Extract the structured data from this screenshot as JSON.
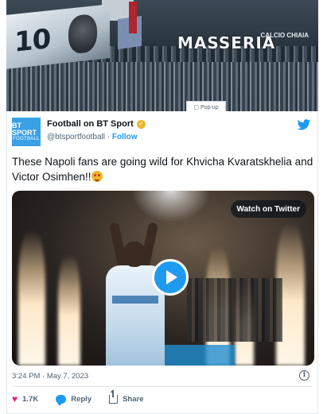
{
  "banner": {
    "flag_number": "10",
    "sign_text": "MASSERIA",
    "sign_side": "CALCIO CHIAIA",
    "popup_label": "Pop-up"
  },
  "tweet": {
    "account_name": "Football on BT Sport",
    "avatar_line1": "BT SPORT",
    "avatar_line2": "FOOTBALL",
    "handle": "@btsportfootball",
    "separator": " · ",
    "follow_label": "Follow",
    "text": "These Napoli fans are going wild for Khvicha Kvaratskhelia and Victor Osimhen!!",
    "watch_label": "Watch on Twitter",
    "timestamp": "3:24 PM · May 7, 2023",
    "info_icon": "i",
    "likes": "1.7K",
    "reply_label": "Reply",
    "share_label": "Share"
  },
  "colors": {
    "accent": "#1d9bf0",
    "like": "#f91880",
    "verified": "#e8b92d"
  },
  "icons": {
    "verified": "verified-badge-icon",
    "bird": "twitter-bird-icon",
    "play": "play-icon",
    "info": "info-icon",
    "like": "heart-icon",
    "reply": "reply-bubble-icon",
    "share": "share-icon"
  }
}
